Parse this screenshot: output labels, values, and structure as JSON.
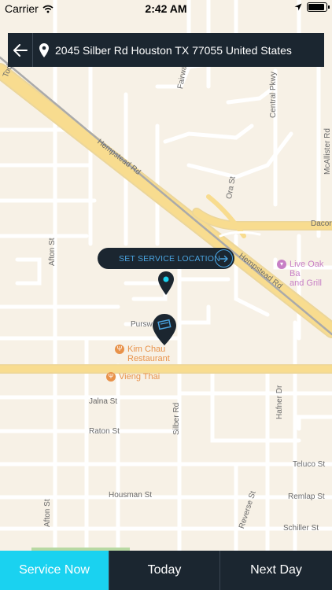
{
  "status_bar": {
    "carrier": "Carrier",
    "time": "2:42 AM"
  },
  "search_bar": {
    "address": "2045 Silber Rd Houston TX 77055 United States"
  },
  "map": {
    "streets": {
      "fairway": "Fairway Pa",
      "central": "Central Pkwy",
      "mcallister": "McAllister Rd",
      "todd": "Todd St",
      "hempstead1": "Hempstead Rd",
      "hempstead2": "Hempstead Rd",
      "ora": "Ora St",
      "dacoma": "Dacor",
      "afton1": "Afton St",
      "afton2": "Afton St",
      "purswell": "Purswe",
      "jalna": "Jalna St",
      "raton": "Raton St",
      "silber": "Silber Rd",
      "hafner": "Hafner Dr",
      "teluco": "Teluco St",
      "housman": "Housman St",
      "remlap": "Remlap St",
      "reverse": "Reverse St",
      "schiller": "Schiller St"
    },
    "pois": {
      "kim_chau": "Kim Chau\nRestaurant",
      "vieng_thai": "Vieng Thai",
      "live_oak": "Live Oak Ba\nand Grill"
    }
  },
  "set_location": {
    "label": "SET SERVICE LOCATION"
  },
  "tabs": {
    "service_now": "Service Now",
    "today": "Today",
    "next_day": "Next Day"
  },
  "colors": {
    "accent": "#1ad2f0",
    "bar": "#1b2630",
    "link": "#4aa3df",
    "road_major": "#f8dc8f",
    "poi_food": "#e8924a",
    "poi_bar": "#c77fc6"
  }
}
